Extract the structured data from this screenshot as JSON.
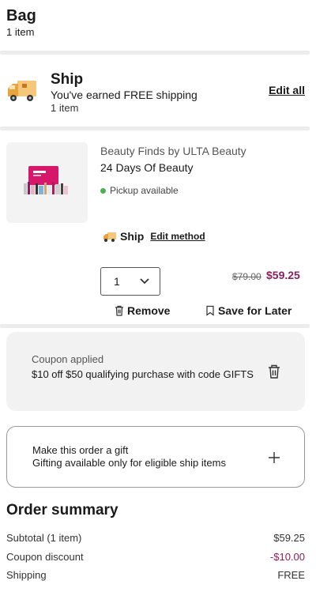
{
  "header": {
    "title": "Bag",
    "count": "1 item"
  },
  "ship_section": {
    "title": "Ship",
    "subtitle": "You've earned FREE shipping",
    "count": "1 item",
    "edit_all": "Edit all"
  },
  "product": {
    "brand": "Beauty Finds by ULTA Beauty",
    "name": "24 Days Of Beauty",
    "pickup": "Pickup available",
    "ship_label": "Ship",
    "edit_method": "Edit method",
    "quantity": "1",
    "price_original": "$79.00",
    "price_sale": "$59.25",
    "remove": "Remove",
    "save_later": "Save for Later"
  },
  "coupon": {
    "label": "Coupon applied",
    "description": "$10 off $50 qualifying purchase with code GIFTS"
  },
  "gift": {
    "title": "Make this order a gift",
    "subtitle": "Gifting available only for eligible ship items"
  },
  "summary": {
    "title": "Order summary",
    "rows": [
      {
        "label": "Subtotal (1 item)",
        "value": "$59.25"
      },
      {
        "label": "Coupon discount",
        "value": "-$10.00"
      },
      {
        "label": "Shipping",
        "value": "FREE"
      }
    ]
  },
  "colors": {
    "accent": "#8c1d5f",
    "truck": "#e8a33c",
    "pickup_dot": "#4caf50"
  },
  "icons": [
    "truck-icon",
    "chevron-down-icon",
    "trash-icon",
    "bookmark-icon",
    "plus-icon"
  ]
}
